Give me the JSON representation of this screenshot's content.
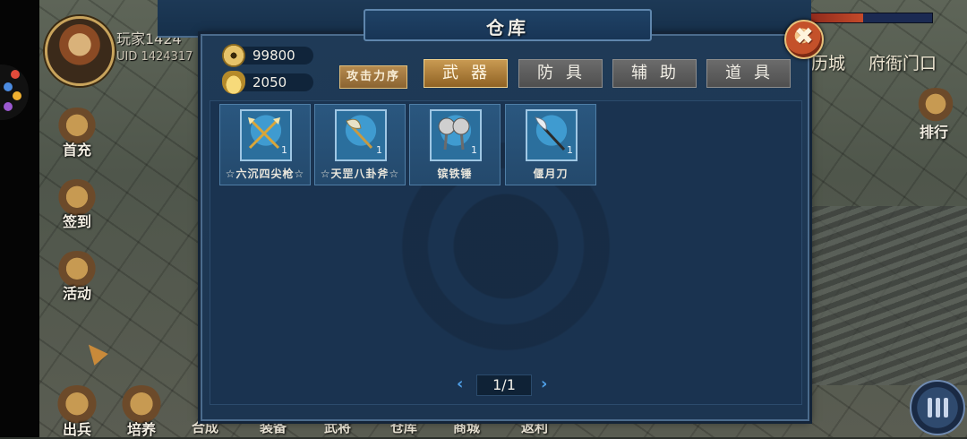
{
  "player": {
    "name": "玩家1424",
    "uid": "UID 1424317"
  },
  "side_menu": [
    {
      "label": "首充"
    },
    {
      "label": "签到"
    },
    {
      "label": "活动"
    }
  ],
  "bottom_bar": [
    {
      "label": "出兵"
    },
    {
      "label": "培养"
    },
    {
      "label": "合成"
    },
    {
      "label": "装备"
    },
    {
      "label": "武将"
    },
    {
      "label": "仓库"
    },
    {
      "label": "商城"
    },
    {
      "label": "返利"
    }
  ],
  "right_nav": {
    "city": "历城",
    "gate": "府衙门口",
    "rank": "排行"
  },
  "dialog": {
    "title": "仓库",
    "close_symbol": "✖",
    "currency": {
      "coins": "99800",
      "ingots": "2050"
    },
    "sort_label": "攻击力序",
    "tabs": [
      {
        "label": "武器",
        "active": true
      },
      {
        "label": "防具",
        "active": false
      },
      {
        "label": "辅助",
        "active": false
      },
      {
        "label": "道具",
        "active": false
      }
    ],
    "items": [
      {
        "name": "☆六沉四尖枪☆",
        "count": "1",
        "icon": "spear-icon"
      },
      {
        "name": "☆天罡八卦斧☆",
        "count": "1",
        "icon": "axe-icon"
      },
      {
        "name": "镔铁锤",
        "count": "1",
        "icon": "hammer-icon"
      },
      {
        "name": "偃月刀",
        "count": "1",
        "icon": "glaive-icon"
      }
    ],
    "pager": {
      "text": "1/1",
      "prev": "‹",
      "next": "›"
    }
  }
}
